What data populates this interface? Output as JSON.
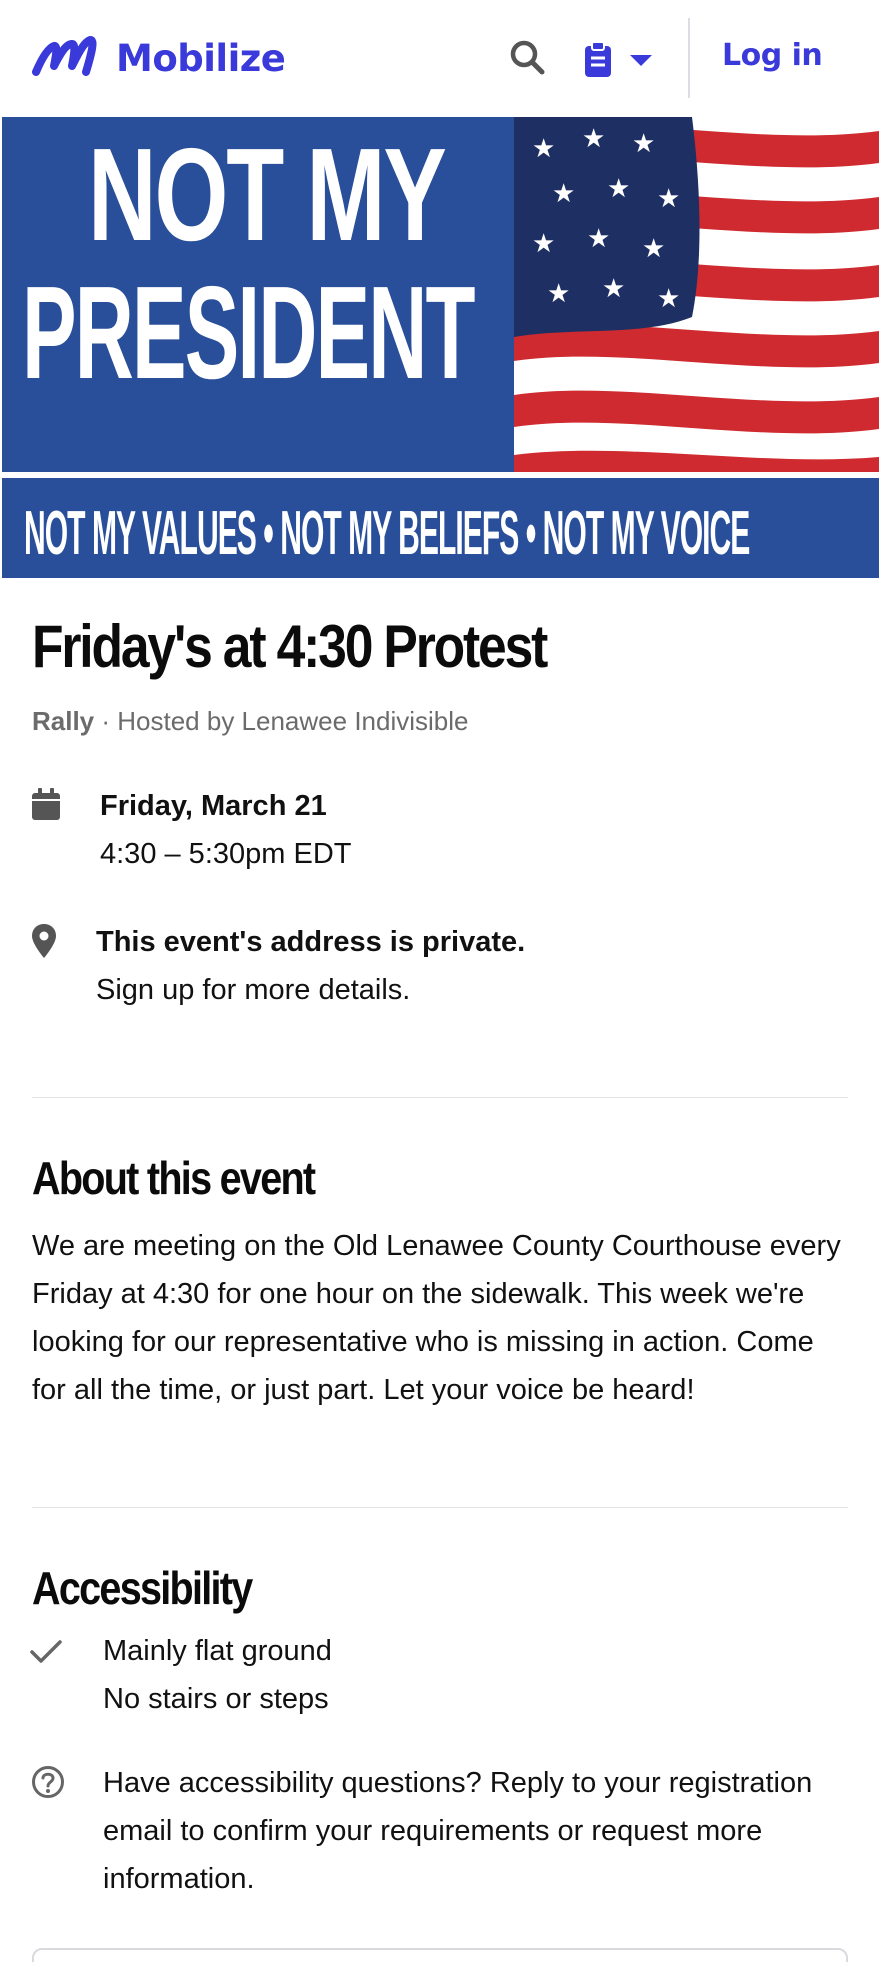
{
  "header": {
    "brand": "Mobilize",
    "login_label": "Log in",
    "icons": [
      "mobilize-logo-icon",
      "search-icon",
      "clipboard-icon",
      "caret-down-icon"
    ],
    "brand_color": "#3a39d9"
  },
  "banner": {
    "line1": "NOT MY",
    "line2": "PRESIDENT",
    "strip": "NOT MY VALUES • NOT MY BELIEFS • NOT MY VOICE",
    "colors": {
      "blue": "#2a4f9a",
      "red": "#cf2a2f",
      "white": "#ffffff"
    }
  },
  "event": {
    "title": "Friday's at 4:30 Protest",
    "type": "Rally",
    "separator": " · ",
    "host": "Hosted by Lenawee Indivisible",
    "date": "Friday, March 21",
    "time": "4:30 – 5:30pm EDT",
    "address_main": "This event's address is private.",
    "address_sub": "Sign up for more details."
  },
  "about": {
    "heading": "About this event",
    "body": "We are meeting on the Old Lenawee County Courthouse every Friday at 4:30 for one hour on the sidewalk. This week we're looking for our representative who is missing in action. Come for all the time, or just part. Let your voice be heard!"
  },
  "accessibility": {
    "heading": "Accessibility",
    "features": [
      "Mainly flat ground",
      "No stairs or steps"
    ],
    "help": "Have accessibility questions? Reply to your registration email to confirm your requirements or request more information."
  }
}
